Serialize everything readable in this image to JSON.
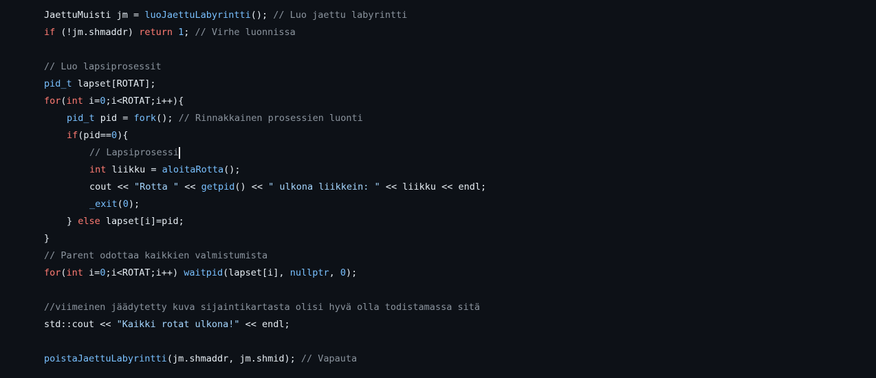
{
  "code": {
    "lines": [
      [
        {
          "c": "t-plain",
          "t": "JaettuMuisti jm = "
        },
        {
          "c": "t-fn",
          "t": "luoJaettuLabyrintti"
        },
        {
          "c": "t-plain",
          "t": "(); "
        },
        {
          "c": "t-cm",
          "t": "// Luo jaettu labyrintti"
        }
      ],
      [
        {
          "c": "t-kw",
          "t": "if"
        },
        {
          "c": "t-plain",
          "t": " (!jm.shmaddr) "
        },
        {
          "c": "t-kw",
          "t": "return"
        },
        {
          "c": "t-plain",
          "t": " "
        },
        {
          "c": "t-num",
          "t": "1"
        },
        {
          "c": "t-plain",
          "t": "; "
        },
        {
          "c": "t-cm",
          "t": "// Virhe luonnissa"
        }
      ],
      [],
      [
        {
          "c": "t-cm",
          "t": "// Luo lapsiprosessit"
        }
      ],
      [
        {
          "c": "t-type",
          "t": "pid_t"
        },
        {
          "c": "t-plain",
          "t": " lapset[ROTAT];"
        }
      ],
      [
        {
          "c": "t-kw",
          "t": "for"
        },
        {
          "c": "t-plain",
          "t": "("
        },
        {
          "c": "t-kw",
          "t": "int"
        },
        {
          "c": "t-plain",
          "t": " i="
        },
        {
          "c": "t-num",
          "t": "0"
        },
        {
          "c": "t-plain",
          "t": ";i<ROTAT;i++){"
        }
      ],
      [
        {
          "c": "t-type",
          "t": "pid_t"
        },
        {
          "c": "t-plain",
          "t": " pid = "
        },
        {
          "c": "t-fn",
          "t": "fork"
        },
        {
          "c": "t-plain",
          "t": "(); "
        },
        {
          "c": "t-cm",
          "t": "// Rinnakkainen prosessien luonti"
        }
      ],
      [
        {
          "c": "t-kw",
          "t": "if"
        },
        {
          "c": "t-plain",
          "t": "(pid=="
        },
        {
          "c": "t-num",
          "t": "0"
        },
        {
          "c": "t-plain",
          "t": "){"
        }
      ],
      [
        {
          "c": "t-cm",
          "t": "// Lapsiprosessi"
        }
      ],
      [
        {
          "c": "t-kw",
          "t": "int"
        },
        {
          "c": "t-plain",
          "t": " liikku = "
        },
        {
          "c": "t-fn",
          "t": "aloitaRotta"
        },
        {
          "c": "t-plain",
          "t": "();"
        }
      ],
      [
        {
          "c": "t-plain",
          "t": "cout << "
        },
        {
          "c": "t-str",
          "t": "\"Rotta \""
        },
        {
          "c": "t-plain",
          "t": " << "
        },
        {
          "c": "t-fn",
          "t": "getpid"
        },
        {
          "c": "t-plain",
          "t": "() << "
        },
        {
          "c": "t-str",
          "t": "\" ulkona liikkein: \""
        },
        {
          "c": "t-plain",
          "t": " << liikku << endl;"
        }
      ],
      [
        {
          "c": "t-fn",
          "t": "_exit"
        },
        {
          "c": "t-plain",
          "t": "("
        },
        {
          "c": "t-num",
          "t": "0"
        },
        {
          "c": "t-plain",
          "t": ");"
        }
      ],
      [
        {
          "c": "t-plain",
          "t": "} "
        },
        {
          "c": "t-kw",
          "t": "else"
        },
        {
          "c": "t-plain",
          "t": " lapset[i]=pid;"
        }
      ],
      [
        {
          "c": "t-plain",
          "t": "}"
        }
      ],
      [
        {
          "c": "t-cm",
          "t": "// Parent odottaa kaikkien valmistumista"
        }
      ],
      [
        {
          "c": "t-kw",
          "t": "for"
        },
        {
          "c": "t-plain",
          "t": "("
        },
        {
          "c": "t-kw",
          "t": "int"
        },
        {
          "c": "t-plain",
          "t": " i="
        },
        {
          "c": "t-num",
          "t": "0"
        },
        {
          "c": "t-plain",
          "t": ";i<ROTAT;i++) "
        },
        {
          "c": "t-fn",
          "t": "waitpid"
        },
        {
          "c": "t-plain",
          "t": "(lapset[i], "
        },
        {
          "c": "t-num",
          "t": "nullptr"
        },
        {
          "c": "t-plain",
          "t": ", "
        },
        {
          "c": "t-num",
          "t": "0"
        },
        {
          "c": "t-plain",
          "t": ");"
        }
      ],
      [],
      [
        {
          "c": "t-cm",
          "t": "//viimeinen jäädytetty kuva sijaintikartasta olisi hyvä olla todistamassa sitä"
        }
      ],
      [
        {
          "c": "t-plain",
          "t": "std::cout << "
        },
        {
          "c": "t-str",
          "t": "\"Kaikki rotat ulkona!\""
        },
        {
          "c": "t-plain",
          "t": " << endl;"
        }
      ],
      [],
      [
        {
          "c": "t-fn",
          "t": "poistaJaettuLabyrintti"
        },
        {
          "c": "t-plain",
          "t": "(jm.shmaddr, jm.shmid); "
        },
        {
          "c": "t-cm",
          "t": "// Vapauta"
        }
      ]
    ]
  },
  "colors": {
    "background": "#0d1117",
    "plain": "#e6edf3",
    "function": "#79c0ff",
    "keyword": "#ff7b72",
    "comment": "#8b949e",
    "string": "#a5d6ff"
  }
}
